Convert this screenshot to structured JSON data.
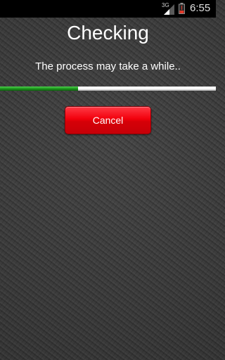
{
  "status_bar": {
    "network_label": "3G",
    "time": "6:55",
    "battery_level": "low",
    "colors": {
      "background": "#000000",
      "battery": "#e23a2a"
    }
  },
  "dialog": {
    "title": "Checking",
    "message": "The process may take a while..",
    "progress_percent": 36,
    "cancel_label": "Cancel"
  },
  "icons": [
    "signal-icon",
    "battery-icon"
  ],
  "colors": {
    "progress_fill": "#1f9a1f",
    "progress_track": "#f2f2f2",
    "cancel_button": "#e8000b",
    "background": "#3b3b3b"
  }
}
